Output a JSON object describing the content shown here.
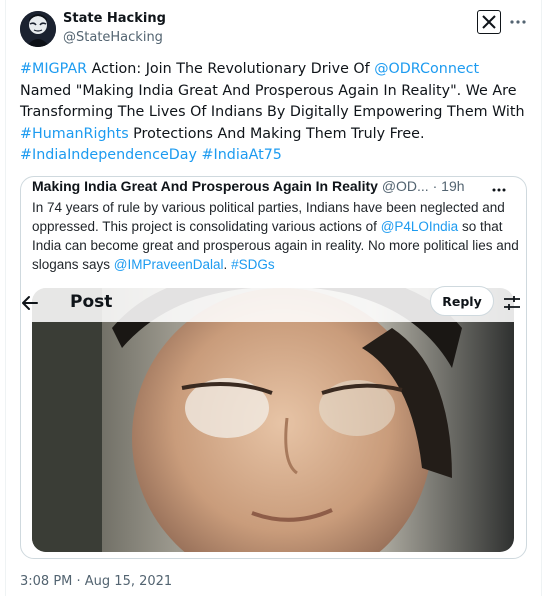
{
  "author": {
    "display_name": "State Hacking",
    "handle": "@StateHacking",
    "avatar_icon": "hacker-mask-avatar"
  },
  "header": {
    "logo_icon": "x-logo-icon",
    "more_icon": "more-dots-icon"
  },
  "tweet": {
    "segments": [
      {
        "text": "#MIGPAR",
        "link": true
      },
      {
        "text": " Action: Join The Revolutionary Drive Of ",
        "link": false
      },
      {
        "text": "@ODRConnect",
        "link": true
      },
      {
        "text": " Named \"Making India Great And Prosperous Again In Reality\". We Are Transforming The Lives Of Indians By Digitally Empowering Them With ",
        "link": false
      },
      {
        "text": "#HumanRights",
        "link": true
      },
      {
        "text": " Protections And Making Them Truly Free. ",
        "link": false
      },
      {
        "text": "#IndiaIndependenceDay",
        "link": true
      },
      {
        "text": " ",
        "link": false
      },
      {
        "text": "#IndiaAt75",
        "link": true
      }
    ],
    "timestamp": "3:08 PM · Aug 15, 2021"
  },
  "quote": {
    "title": "Making India Great And Prosperous Again In Reality",
    "handle": "@OD...",
    "sep": " · ",
    "age": "19h",
    "body_segments": [
      {
        "text": "In 74 years of rule by various political parties, Indians have been neglected and oppressed. This project is consolidating various actions of ",
        "link": false
      },
      {
        "text": "@P4LOIndia",
        "link": true
      },
      {
        "text": " so that India can become great and prosperous again in reality. No more political lies and slogans says ",
        "link": false
      },
      {
        "text": "@IMPraveenDalal",
        "link": true
      },
      {
        "text": ". ",
        "link": false
      },
      {
        "text": "#SDGs",
        "link": true
      }
    ],
    "overlay": {
      "back_icon": "arrow-left-icon",
      "title": "Post",
      "reply_label": "Reply",
      "tune_icon": "sliders-icon"
    },
    "photo_alt_icon": "portrait-photo"
  },
  "colors": {
    "link": "#1d9bf0",
    "text": "#0f1419",
    "muted": "#536471",
    "border": "#cfd9de"
  }
}
